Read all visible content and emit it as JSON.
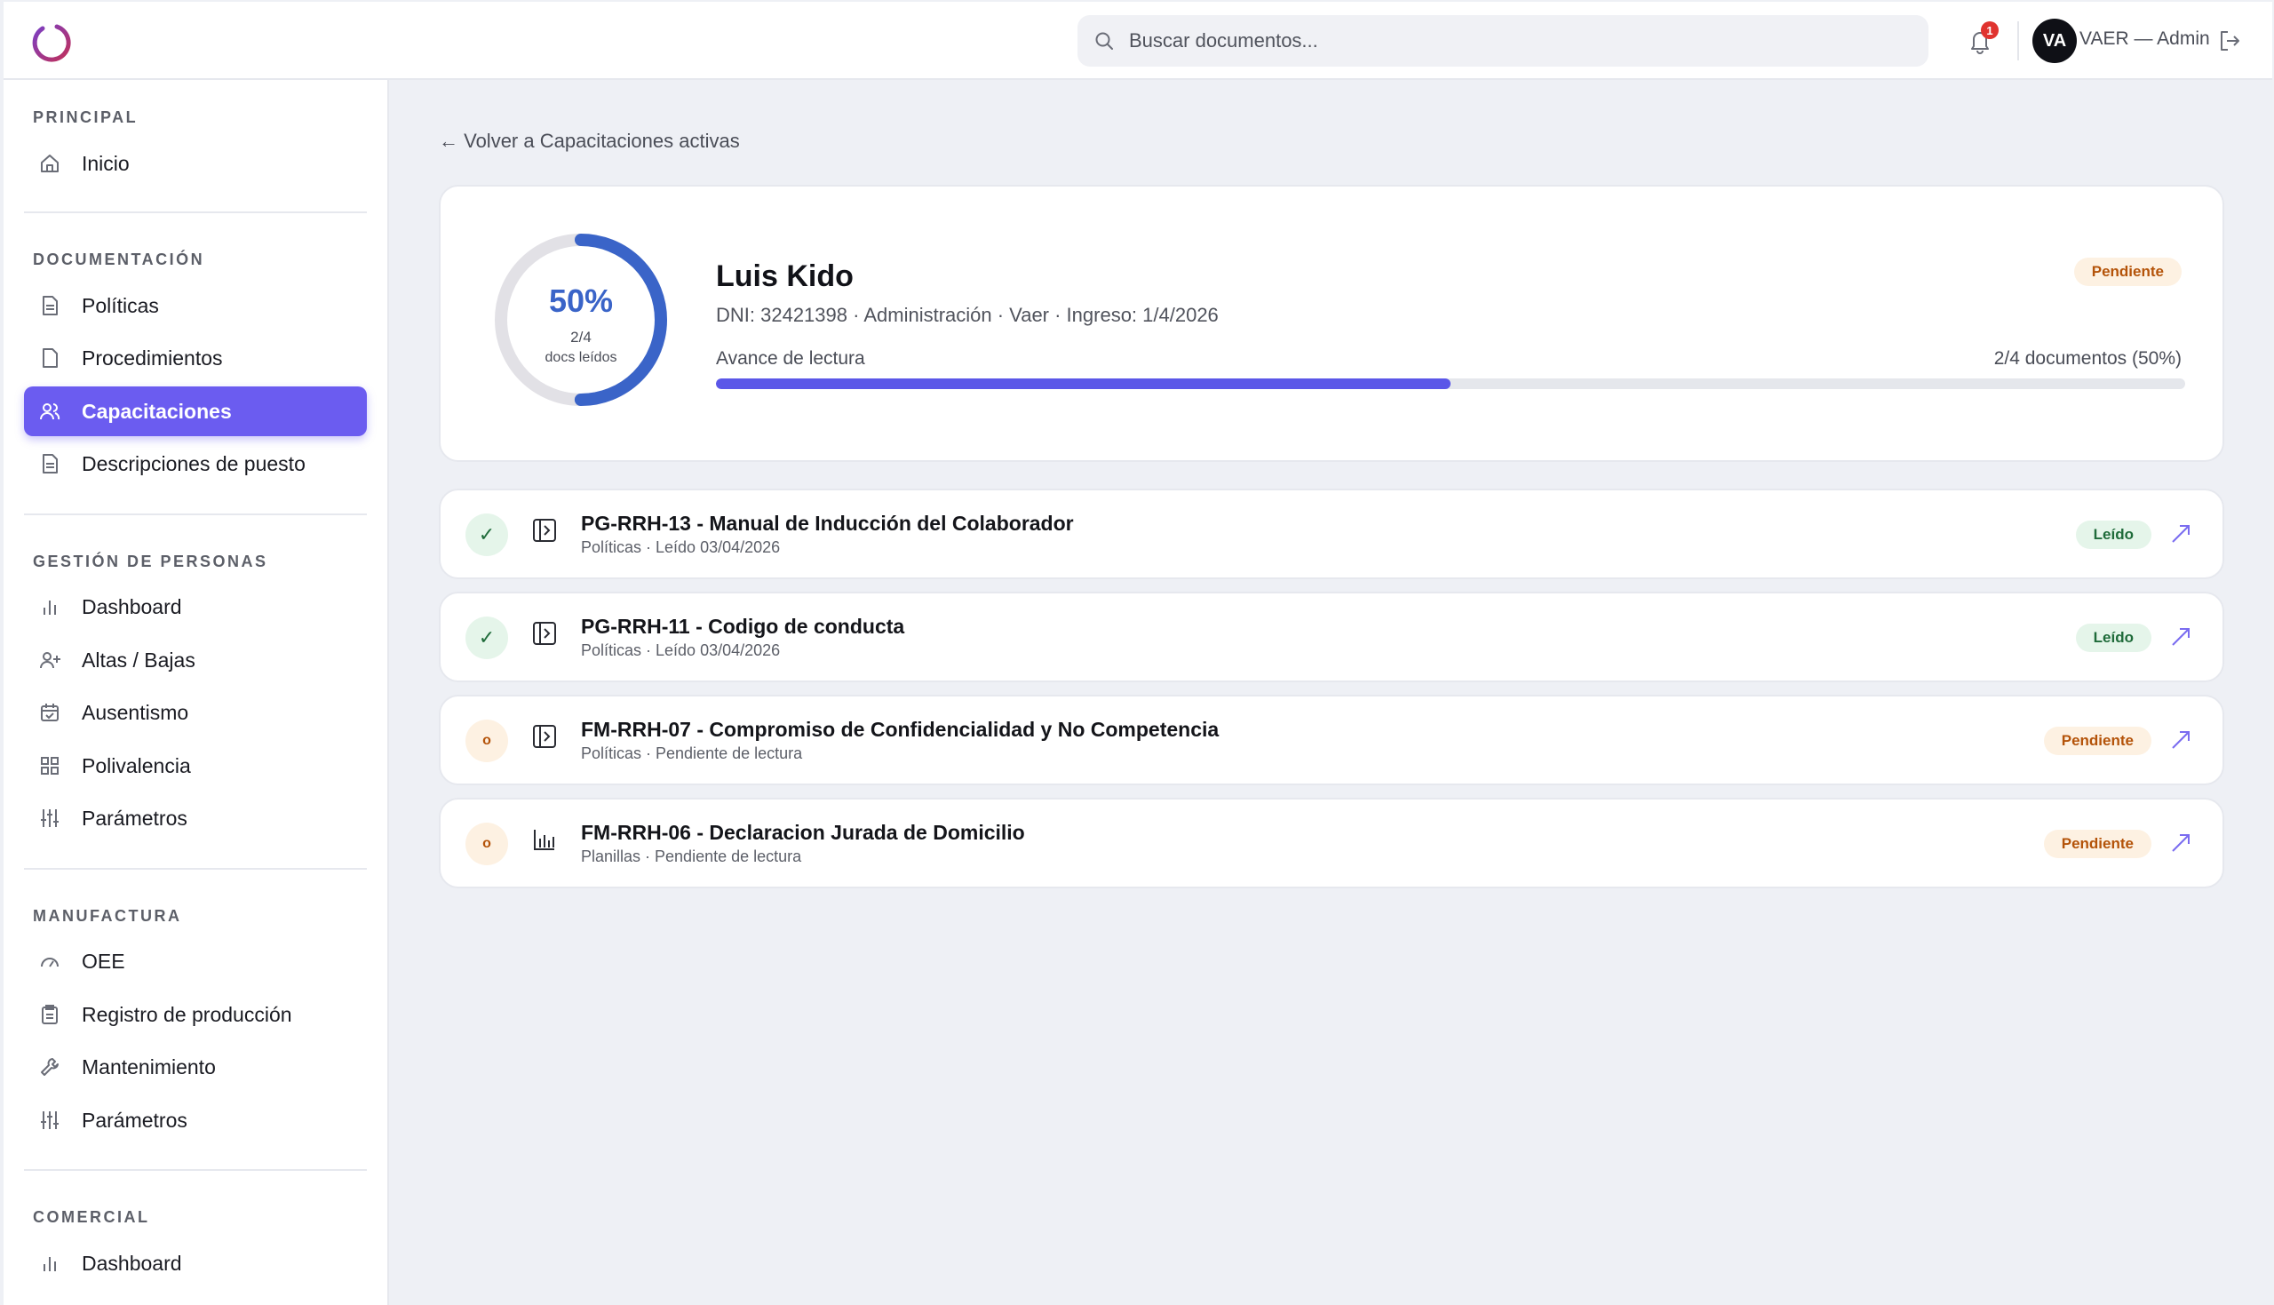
{
  "topbar": {
    "search_placeholder": "Buscar documentos...",
    "notification_count": "1",
    "avatar_initials": "VA",
    "user_label": "VAER — Admin"
  },
  "sidebar": {
    "sections": [
      {
        "title": "PRINCIPAL",
        "items": [
          "Inicio"
        ]
      },
      {
        "title": "DOCUMENTACIÓN",
        "items": [
          "Políticas",
          "Procedimientos",
          "Capacitaciones",
          "Descripciones de puesto"
        ]
      },
      {
        "title": "GESTIÓN DE PERSONAS",
        "items": [
          "Dashboard",
          "Altas / Bajas",
          "Ausentismo",
          "Polivalencia",
          "Parámetros"
        ]
      },
      {
        "title": "MANUFACTURA",
        "items": [
          "OEE",
          "Registro de producción",
          "Mantenimiento",
          "Parámetros"
        ]
      },
      {
        "title": "COMERCIAL",
        "items": [
          "Dashboard"
        ]
      }
    ],
    "active_item": "Capacitaciones"
  },
  "main": {
    "back_link": "← Volver a Capacitaciones activas",
    "summary": {
      "percent_label": "50%",
      "percent_value": 50,
      "count_label": "2/4",
      "count_sub": "docs leídos",
      "name": "Luis Kido",
      "meta": "DNI: 32421398 · Administración · Vaer · Ingreso: 1/4/2026",
      "status": "Pendiente",
      "progress_label": "Avance de lectura",
      "progress_right": "2/4 documentos (50%)"
    },
    "documents": [
      {
        "code_title": "PG-RRH-13 - Manual de Inducción del Colaborador",
        "subtitle": "Políticas · Leído 03/04/2026",
        "status": "Leído",
        "read": true,
        "icon": "document-icon",
        "status_glyph": "✓"
      },
      {
        "code_title": "PG-RRH-11 - Codigo de conducta",
        "subtitle": "Políticas · Leído 03/04/2026",
        "status": "Leído",
        "read": true,
        "icon": "document-icon",
        "status_glyph": "✓"
      },
      {
        "code_title": "FM-RRH-07 - Compromiso de Confidencialidad y No Competencia",
        "subtitle": "Políticas · Pendiente de lectura",
        "status": "Pendiente",
        "read": false,
        "icon": "document-icon",
        "status_glyph": "o"
      },
      {
        "code_title": "FM-RRH-06 - Declaracion Jurada de Domicilio",
        "subtitle": "Planillas · Pendiente de lectura",
        "status": "Pendiente",
        "read": false,
        "icon": "chart-icon",
        "status_glyph": "o"
      }
    ]
  },
  "colors": {
    "accent": "#6b5cf0",
    "ring": "#3a64c8",
    "progress": "#5b57e8",
    "pending_bg": "#fdf1e2",
    "pending_text": "#b45309",
    "read_bg": "#e5f5ea",
    "read_text": "#1f6b3a"
  }
}
